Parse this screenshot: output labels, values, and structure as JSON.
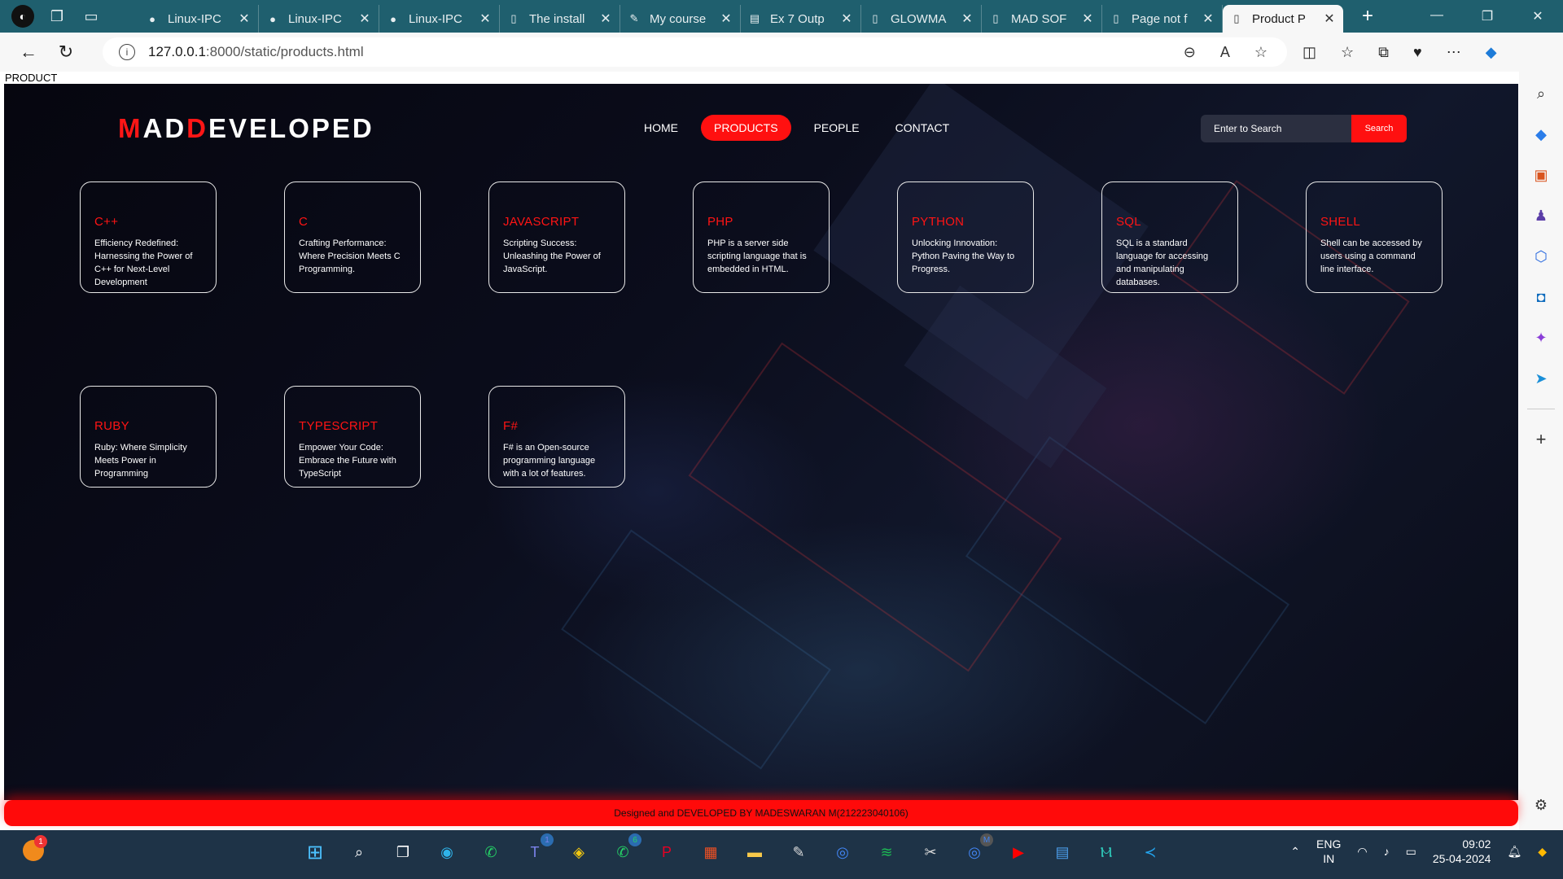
{
  "browser": {
    "tabs": [
      {
        "title": "Linux-IPC",
        "icon": "github-icon"
      },
      {
        "title": "Linux-IPC",
        "icon": "github-icon"
      },
      {
        "title": "Linux-IPC",
        "icon": "github-icon"
      },
      {
        "title": "The install",
        "icon": "document-icon"
      },
      {
        "title": "My course",
        "icon": "course-icon"
      },
      {
        "title": "Ex 7 Outp",
        "icon": "pdf-icon"
      },
      {
        "title": "GLOWMA",
        "icon": "document-icon"
      },
      {
        "title": "MAD SOF",
        "icon": "document-icon"
      },
      {
        "title": "Page not f",
        "icon": "document-icon"
      },
      {
        "title": "Product P",
        "icon": "document-icon",
        "active": true
      }
    ],
    "url_host": "127.0.0.1",
    "url_path": ":8000/static/products.html"
  },
  "page": {
    "doc_title": "PRODUCT",
    "logo": {
      "m": "M",
      "ad": "AD",
      "d": "D",
      "eveloped": "EVELOPED"
    },
    "nav": {
      "home": "HOME",
      "products": "PRODUCTS",
      "people": "PEOPLE",
      "contact": "CONTACT"
    },
    "search": {
      "placeholder": "Enter to Search",
      "button": "Search"
    },
    "cards": [
      {
        "title": "C++",
        "desc": "Efficiency Redefined: Harnessing the Power of C++ for Next-Level Development"
      },
      {
        "title": "C",
        "desc": "Crafting Performance: Where Precision Meets C Programming."
      },
      {
        "title": "JAVASCRIPT",
        "desc": "Scripting Success: Unleashing the Power of JavaScript."
      },
      {
        "title": "PHP",
        "desc": "PHP is a server side scripting language that is embedded in HTML."
      },
      {
        "title": "PYTHON",
        "desc": "Unlocking Innovation: Python Paving the Way to Progress."
      },
      {
        "title": "SQL",
        "desc": "SQL is a standard language for accessing and manipulating databases."
      },
      {
        "title": "SHELL",
        "desc": "Shell can be accessed by users using a command line interface."
      },
      {
        "title": "RUBY",
        "desc": "Ruby: Where Simplicity Meets Power in Programming"
      },
      {
        "title": "TYPESCRIPT",
        "desc": "Empower Your Code: Embrace the Future with TypeScript"
      },
      {
        "title": "F#",
        "desc": "F# is an Open-source programming language with a lot of features."
      }
    ],
    "footer": "Designed and DEVELOPED BY MADESWARAN M(212223040106)"
  },
  "taskbar": {
    "notification_count": "1",
    "teams_count": "1",
    "whatsapp_count": "6",
    "chrome_profile": "M",
    "lang_top": "ENG",
    "lang_bottom": "IN",
    "time": "09:02",
    "date": "25-04-2024"
  },
  "colors": {
    "accent": "#ff1010",
    "tab_bar": "#1f5f6e",
    "taskbar": "#1e3347"
  }
}
